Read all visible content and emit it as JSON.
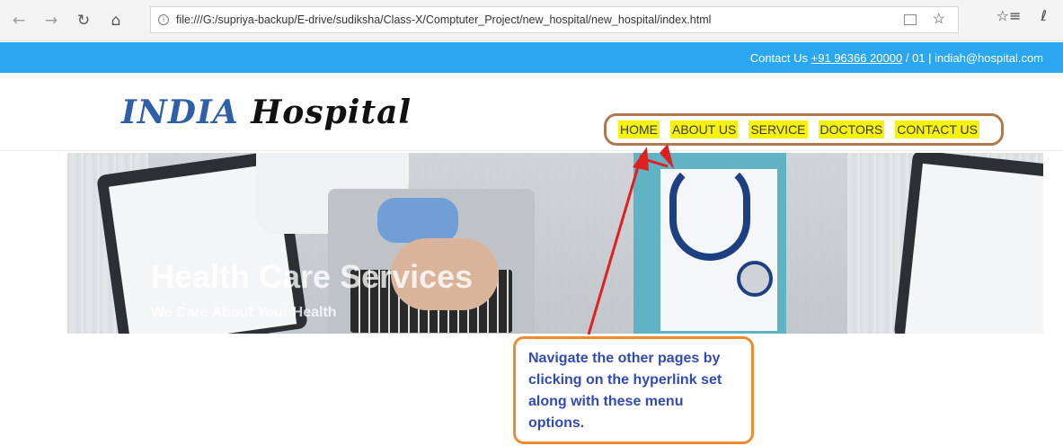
{
  "browser": {
    "url": "file:///G:/supriya-backup/E-drive/sudiksha/Class-X/Comptuter_Project/new_hospital/new_hospital/index.html",
    "icons": [
      "back-icon",
      "forward-icon",
      "refresh-icon",
      "home-icon",
      "info-icon",
      "reading-view-icon",
      "favorite-star-icon",
      "favorites-list-icon",
      "pen-icon"
    ]
  },
  "topbar": {
    "contact_label": "Contact Us",
    "phone": "+91 96366 20000",
    "phone_suffix": "/ 01 | indiah@hospital.com"
  },
  "header": {
    "logo_part1": "INDIA",
    "logo_part2": "Hospital",
    "menu": [
      "HOME",
      "ABOUT US",
      "SERVICE",
      "DOCTORS",
      "CONTACT US"
    ]
  },
  "banner": {
    "title": "Health Care Services",
    "subtitle": "We Care About Your Health"
  },
  "annotation": {
    "text": "Navigate the other pages by clicking on the hyperlink set along with these menu options."
  },
  "colors": {
    "topbar": "#2aa7ee",
    "logo_blue": "#2f5fa8",
    "menu_highlight": "#f6f20d",
    "menu_box_border": "#b07a50",
    "callout_border": "#ef8a2f",
    "callout_text": "#3349b6",
    "arrow": "#e02020"
  }
}
